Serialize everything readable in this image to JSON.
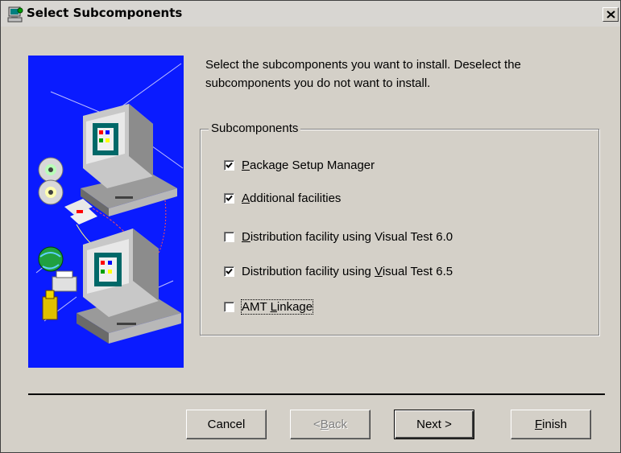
{
  "window": {
    "title": "Select Subcomponents"
  },
  "instructions": "Select the subcomponents you want to install.  Deselect the subcomponents you do not want to install.",
  "group": {
    "label": "Subcomponents",
    "options": [
      {
        "pre": "",
        "accel": "P",
        "post": "ackage Setup Manager",
        "checked": true
      },
      {
        "pre": "",
        "accel": "A",
        "post": "dditional facilities",
        "checked": true
      },
      {
        "pre": "",
        "accel": "D",
        "post": "istribution facility using Visual Test 6.0",
        "checked": false
      },
      {
        "pre": "Distribution facility using ",
        "accel": "V",
        "post": "isual Test 6.5",
        "checked": true
      },
      {
        "pre": "AMT ",
        "accel": "L",
        "post": "inkage",
        "checked": false
      }
    ]
  },
  "buttons": {
    "cancel": {
      "pre": "Cancel",
      "accel": "",
      "post": ""
    },
    "back": {
      "pre": "< ",
      "accel": "B",
      "post": "ack",
      "enabled": false
    },
    "next": {
      "pre": "Next >",
      "accel": "",
      "post": ""
    },
    "finish": {
      "pre": "",
      "accel": "F",
      "post": "inish"
    }
  },
  "icons": {
    "title": "installer-computer-icon",
    "close": "close-x-icon",
    "illustration": "networked-computers-illustration"
  },
  "colors": {
    "illustration_bg": "#0a1bff",
    "window_face": "#d4d0c8"
  }
}
